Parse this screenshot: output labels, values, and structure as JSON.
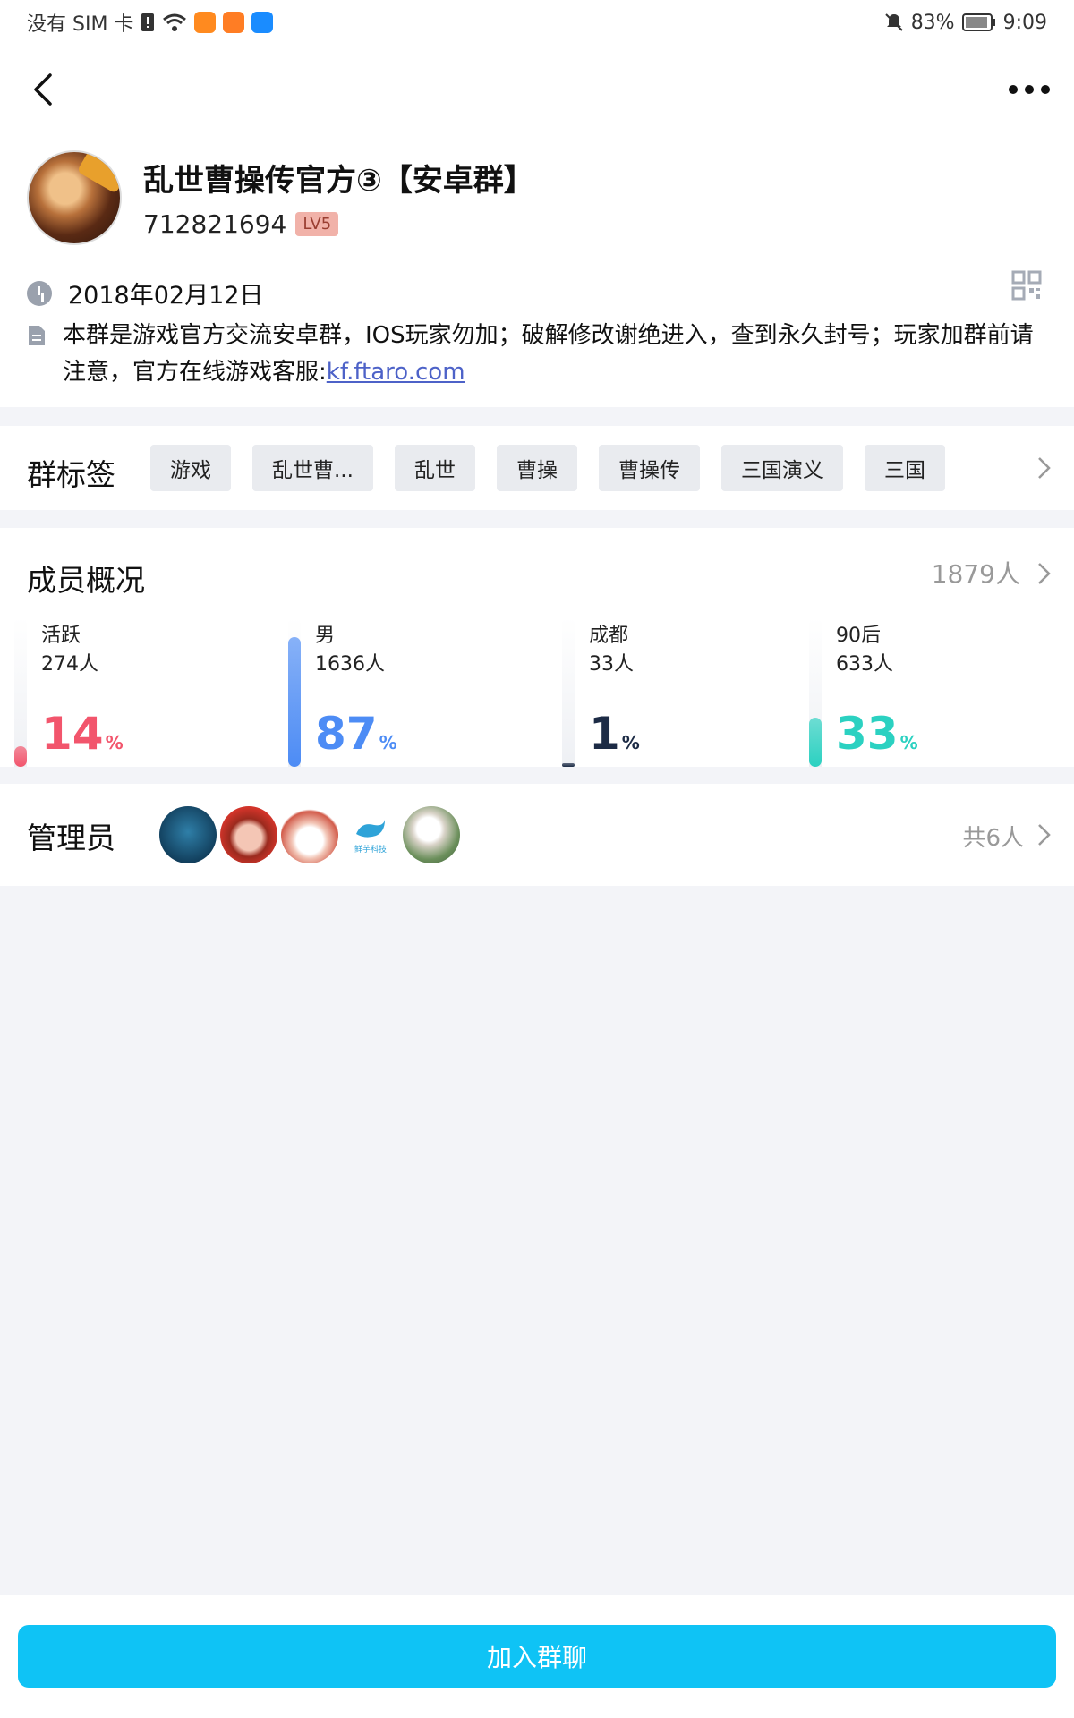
{
  "status_bar": {
    "carrier": "没有 SIM 卡",
    "battery": "83%",
    "time": "9:09"
  },
  "group": {
    "name": "乱世曹操传官方③【安卓群】",
    "id": "712821694",
    "level": "LV5",
    "created_date": "2018年02月12日",
    "description_text": "本群是游戏官方交流安卓群，IOS玩家勿加；破解修改谢绝进入，查到永久封号；玩家加群前请注意，官方在线游戏客服:",
    "description_link": "kf.ftaro.com"
  },
  "tags": {
    "title": "群标签",
    "items": [
      "游戏",
      "乱世曹...",
      "乱世",
      "曹操",
      "曹操传",
      "三国演义",
      "三国"
    ]
  },
  "members": {
    "title": "成员概况",
    "total": "1879人",
    "stats": [
      {
        "label": "活跃",
        "count": "274人",
        "percent": "14",
        "pct_sign": "%",
        "fill": 0.14,
        "color": "#f2556c"
      },
      {
        "label": "男",
        "count": "1636人",
        "percent": "87",
        "pct_sign": "%",
        "fill": 0.87,
        "color": "#4d8cf5"
      },
      {
        "label": "成都",
        "count": "33人",
        "percent": "1",
        "pct_sign": "%",
        "fill": 0.01,
        "color": "#1c2b45"
      },
      {
        "label": "90后",
        "count": "633人",
        "percent": "33",
        "pct_sign": "%",
        "fill": 0.33,
        "color": "#2bd1c1"
      }
    ]
  },
  "admins": {
    "title": "管理员",
    "total": "共6人",
    "avatar_text_4": "鲜芋科技"
  },
  "join_button": "加入群聊"
}
